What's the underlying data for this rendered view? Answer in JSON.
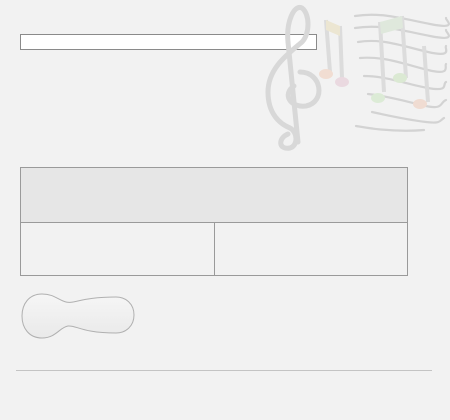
{
  "form": {
    "text_field": {
      "value": "",
      "placeholder": ""
    }
  },
  "graphic": {
    "icon": "music-notes-staff-icon"
  },
  "grid": {
    "header_text": "",
    "cells": [
      "",
      ""
    ]
  },
  "blob_button": {
    "label": ""
  },
  "colors": {
    "background": "#f2f2f2",
    "grid_header": "#e6e6e6",
    "border": "#9a9a9a"
  }
}
